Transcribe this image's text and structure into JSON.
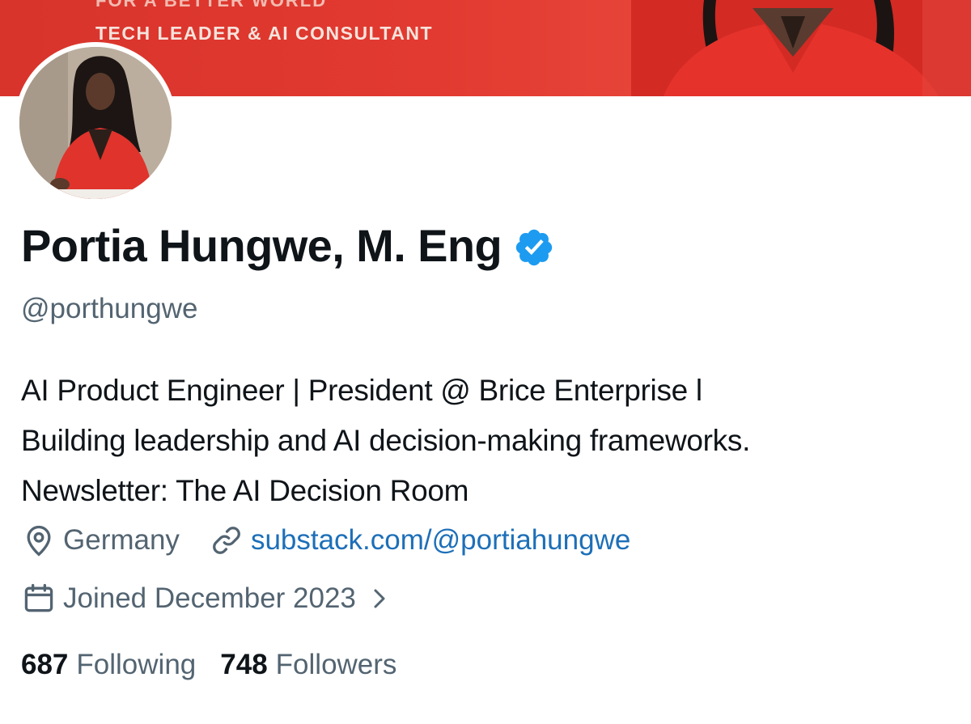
{
  "banner": {
    "top_text": "FOR A BETTER WORLD",
    "tagline": "TECH LEADER & AI CONSULTANT"
  },
  "profile": {
    "display_name": "Portia Hungwe, M. Eng",
    "handle": "@porthungwe",
    "verified_icon": "verified-badge-icon",
    "bio_lines": [
      "AI Product Engineer | President @ Brice Enterprise l",
      "Building leadership and AI decision-making frameworks.",
      "Newsletter: The AI Decision Room"
    ],
    "location": "Germany",
    "website": "substack.com/@portiahungwe",
    "joined": "Joined December 2023",
    "stats": {
      "following_count": "687",
      "following_label": "Following",
      "followers_count": "748",
      "followers_label": "Followers"
    }
  },
  "colors": {
    "banner_red": "#e23a30",
    "verified_blue": "#1d9bf0",
    "link_blue": "#1d6fb8",
    "secondary_text": "#536471",
    "primary_text": "#0f1419"
  },
  "icons": [
    "location-pin-icon",
    "link-icon",
    "calendar-icon",
    "chevron-right-icon"
  ]
}
